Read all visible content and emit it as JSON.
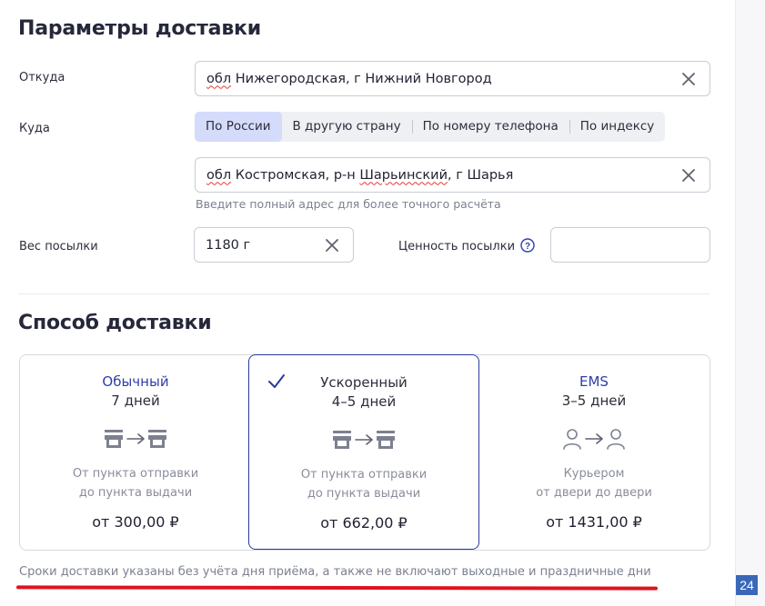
{
  "params": {
    "title": "Параметры доставки",
    "from_label": "Откуда",
    "from_value_prefix": "обл",
    "from_value_rest": " Нижегородская, г Нижний Новгород",
    "to_label": "Куда",
    "tabs": [
      {
        "label": "По России",
        "active": true
      },
      {
        "label": "В другую страну",
        "active": false
      },
      {
        "label": "По номеру телефона",
        "active": false
      },
      {
        "label": "По индексу",
        "active": false
      }
    ],
    "to_value_a": "обл",
    "to_value_b": " Костромская, р-н ",
    "to_value_c": "Шарьинский",
    "to_value_d": ", г Шарья",
    "to_hint": "Введите полный адрес для более точного расчёта",
    "weight_label": "Вес посылки",
    "weight_value": "1180 г",
    "value_label": "Ценность посылки",
    "value_value": ""
  },
  "delivery": {
    "title": "Способ доставки",
    "options": [
      {
        "name": "Обычный",
        "days": "7 дней",
        "icon": "pickup-point-to-pickup-point-icon",
        "desc1": "От пункта отправки",
        "desc2": "до пункта выдачи",
        "price": "от 300,00 ₽",
        "selected": false
      },
      {
        "name": "Ускоренный",
        "days": "4–5 дней",
        "icon": "pickup-point-to-pickup-point-icon",
        "desc1": "От пункта отправки",
        "desc2": "до пункта выдачи",
        "price": "от 662,00 ₽",
        "selected": true
      },
      {
        "name": "EMS",
        "days": "3–5 дней",
        "icon": "person-to-person-icon",
        "desc1": "Курьером",
        "desc2": "от двери до двери",
        "price": "от 1431,00 ₽",
        "selected": false
      }
    ],
    "note": "Сроки доставки указаны без учёта дня приёма, а также не включают выходные и праздничные дни"
  },
  "badge": "24",
  "colors": {
    "accent": "#2a3a9e",
    "tab_active_bg": "#d5dbfa",
    "underline_red": "#e0121f",
    "badge_bg": "#3a68b9"
  }
}
